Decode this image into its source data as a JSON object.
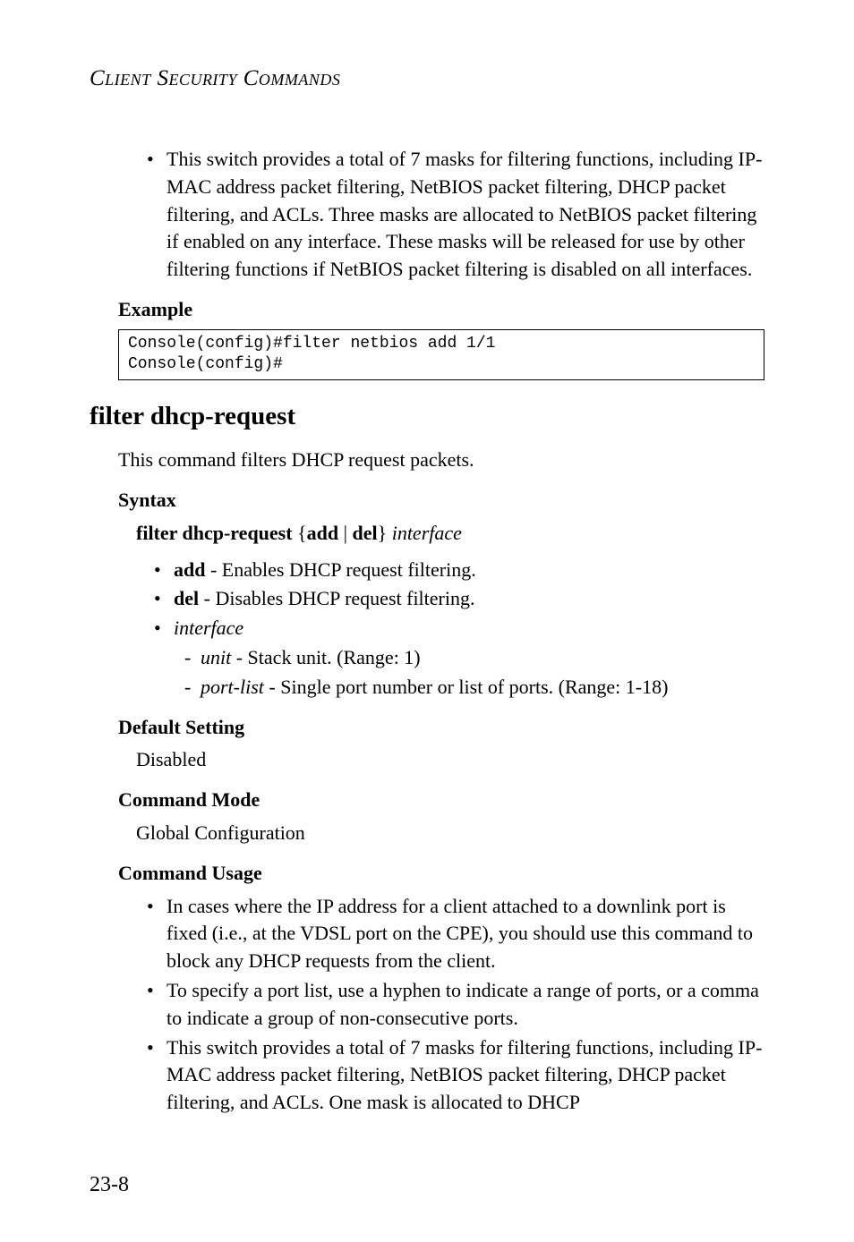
{
  "header": {
    "title": "Client Security Commands"
  },
  "topBullet": {
    "text": "This switch provides a total of 7 masks for filtering functions, including IP-MAC address packet filtering, NetBIOS packet filtering, DHCP packet filtering, and ACLs. Three masks are allocated to NetBIOS packet filtering if enabled on any interface. These masks will be released for use by other filtering functions if NetBIOS packet filtering is disabled on all interfaces."
  },
  "exampleLabel": "Example",
  "exampleCode": "Console(config)#filter netbios add 1/1\nConsole(config)#",
  "heading": "filter dhcp-request",
  "intro": "This command filters DHCP request packets.",
  "syntaxLabel": "Syntax",
  "syntax": {
    "cmd": "filter dhcp-request",
    "braceOpen": "{",
    "opt1": "add",
    "pipe": " | ",
    "opt2": "del",
    "braceClose": "}",
    "arg": "interface"
  },
  "syntaxBullets": {
    "add": {
      "name": "add",
      "desc": " - Enables DHCP request filtering."
    },
    "del": {
      "name": "del",
      "desc": " - Disables DHCP request filtering."
    },
    "interface": {
      "name": "interface"
    },
    "unit": {
      "name": "unit",
      "desc": " - Stack unit. (Range: 1)"
    },
    "portlist": {
      "name": "port-list",
      "desc": " - Single port number or list of ports. (Range: 1-18)"
    }
  },
  "defaultLabel": "Default Setting",
  "defaultValue": "Disabled",
  "modeLabel": "Command Mode",
  "modeValue": "Global Configuration",
  "usageLabel": "Command Usage",
  "usageBullets": {
    "b1": "In cases where the IP address for a client attached to a downlink port is fixed (i.e., at the VDSL port on the CPE), you should use this command to block any DHCP requests from the client.",
    "b2": "To specify a port list, use a hyphen to indicate a range of ports, or a comma to indicate a group of non-consecutive ports.",
    "b3": "This switch provides a total of 7 masks for filtering functions, including IP-MAC address packet filtering, NetBIOS packet filtering, DHCP packet filtering, and ACLs. One mask is allocated to DHCP"
  },
  "pageNumber": "23-8"
}
